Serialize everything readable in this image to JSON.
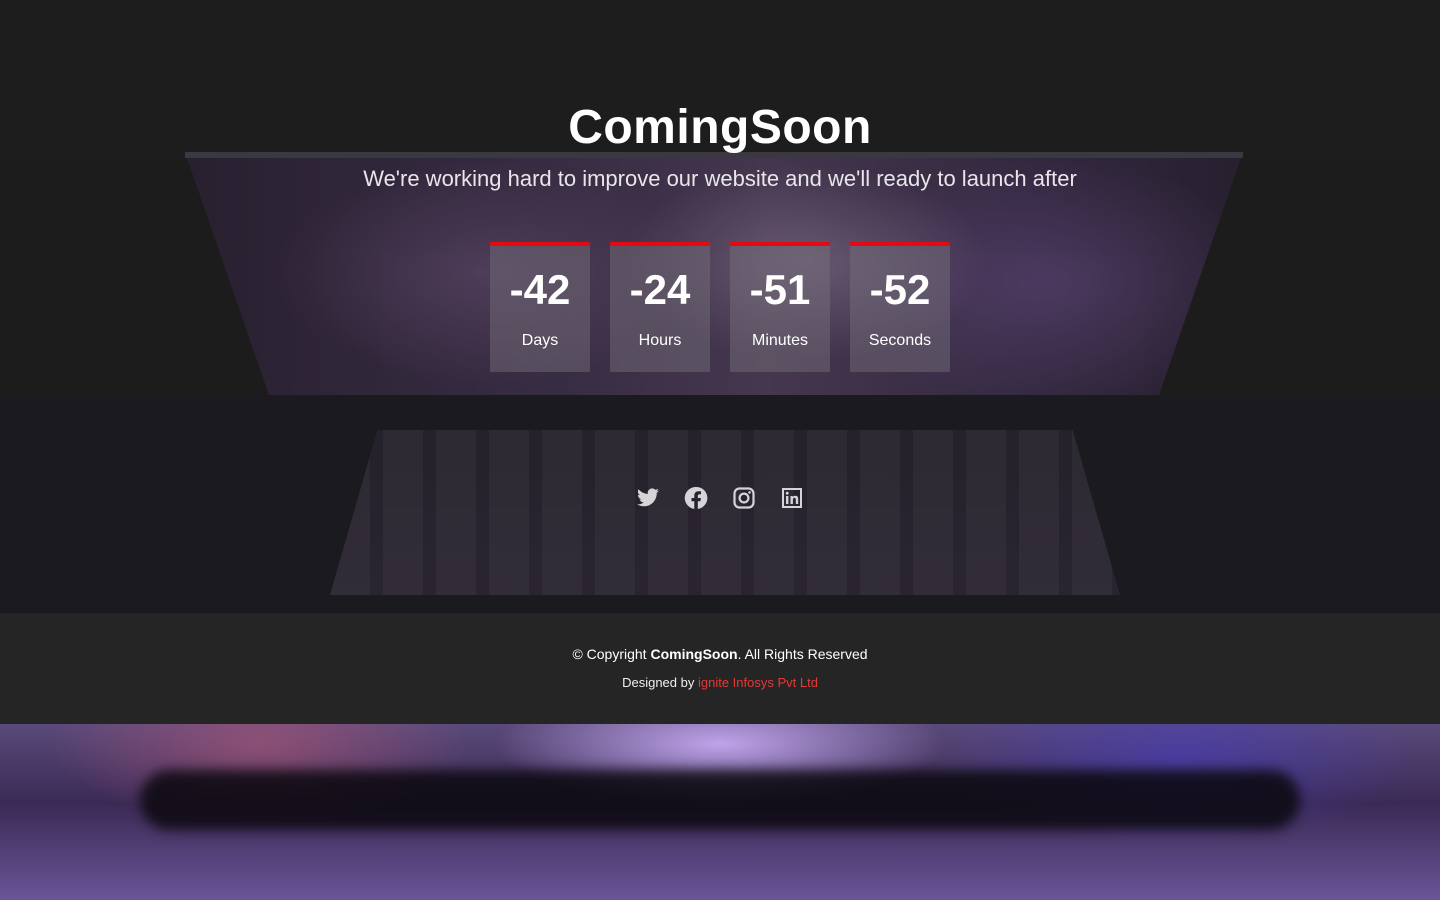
{
  "hero": {
    "title": "ComingSoon",
    "subtitle": "We're working hard to improve our website and we'll ready to launch after"
  },
  "countdown": [
    {
      "value": "-42",
      "label": "Days"
    },
    {
      "value": "-24",
      "label": "Hours"
    },
    {
      "value": "-51",
      "label": "Minutes"
    },
    {
      "value": "-52",
      "label": "Seconds"
    }
  ],
  "social": [
    "twitter-icon",
    "facebook-icon",
    "instagram-icon",
    "linkedin-icon"
  ],
  "footer": {
    "copyright_prefix": "© Copyright ",
    "brand": "ComingSoon",
    "copyright_suffix": ". All Rights Reserved",
    "designed_by": "Designed by ",
    "designer_link": "ignite Infosys Pvt Ltd"
  },
  "colors": {
    "accent": "#e50914",
    "link": "#e53935",
    "background": "#1c1c1d"
  }
}
